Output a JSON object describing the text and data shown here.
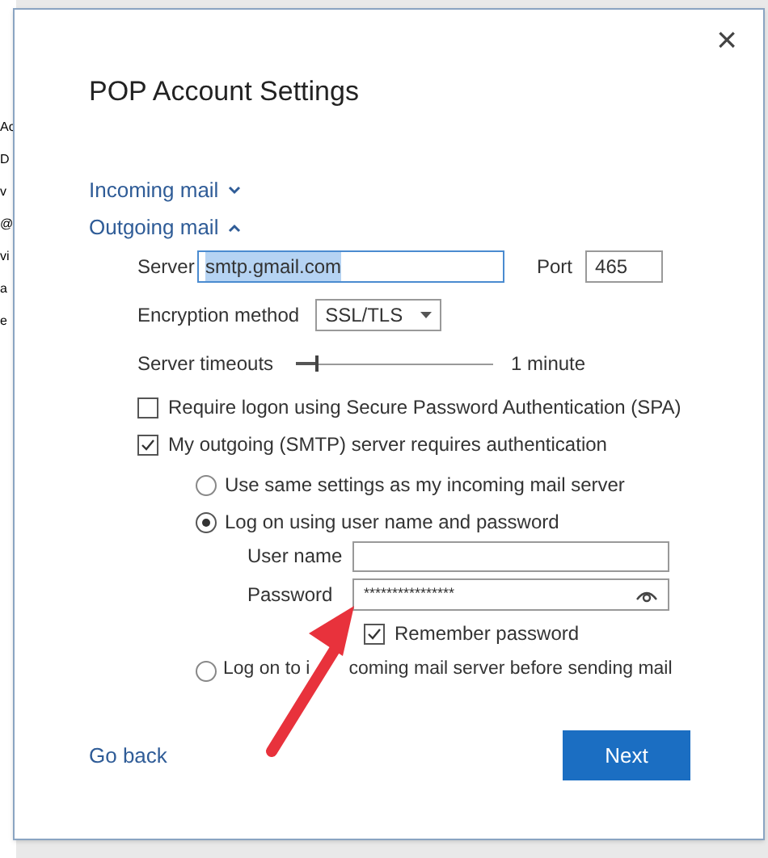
{
  "background_window": {
    "fragments": [
      "Ac",
      "D",
      "v",
      "@",
      "vi",
      "a",
      "e"
    ]
  },
  "dialog": {
    "title": "POP Account Settings",
    "close": "×"
  },
  "sections": [
    {
      "label": "Incoming mail",
      "expanded": false
    },
    {
      "label": "Outgoing mail",
      "expanded": true
    }
  ],
  "outgoing": {
    "server_label": "Server",
    "server": "smtp.gmail.com",
    "port_label": "Port",
    "port": "465",
    "encryption_label": "Encryption method",
    "encryption": "SSL/TLS",
    "timeout_label": "Server timeouts",
    "timeout": {
      "level": 0.1
    },
    "timeout_reading": "1 minute",
    "checkboxes": [
      {
        "label": "Require logon using Secure Password Authentication (SPA)",
        "checked": false
      },
      {
        "label": "My outgoing (SMTP) server requires authentication",
        "checked": true
      }
    ],
    "auth_options": [
      {
        "label": "Use same settings as my incoming mail server",
        "selected": false
      },
      {
        "label": "Log on using user name and password",
        "selected": true
      },
      {
        "label": "Log on to i",
        "label_after_arrow": "coming mail server before sending mail",
        "selected": false
      }
    ],
    "username_label": "User name",
    "password_label": "Password",
    "password": "****************",
    "remember_password": {
      "label": "Remember password",
      "checked": true
    }
  },
  "footer": {
    "back": "Go back",
    "next": "Next"
  }
}
